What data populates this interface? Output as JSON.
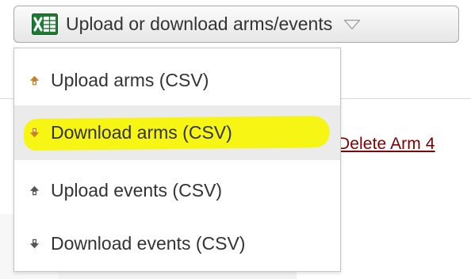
{
  "toggle": {
    "label": "Upload or download arms/events",
    "icon": "excel-icon",
    "caret_icon": "chevron-down-icon"
  },
  "menu": {
    "items": [
      {
        "label": "Upload arms (CSV)",
        "icon": "upload-arrow-icon",
        "icon_color": "#c8802a"
      },
      {
        "label": "Download arms (CSV)",
        "icon": "download-arrow-icon",
        "icon_color": "#c8802a",
        "hovered": true,
        "highlight_color": "#f6f500"
      },
      {
        "label": "Upload events (CSV)",
        "icon": "upload-arrow-icon",
        "icon_color": "#555555"
      },
      {
        "label": "Download events (CSV)",
        "icon": "download-arrow-icon",
        "icon_color": "#555555"
      }
    ]
  },
  "background": {
    "link_label": "Delete Arm 4",
    "link_color": "#800000"
  },
  "colors": {
    "text": "#333333",
    "hover_bg": "#ebebeb",
    "excel_green": "#1e7b34"
  }
}
